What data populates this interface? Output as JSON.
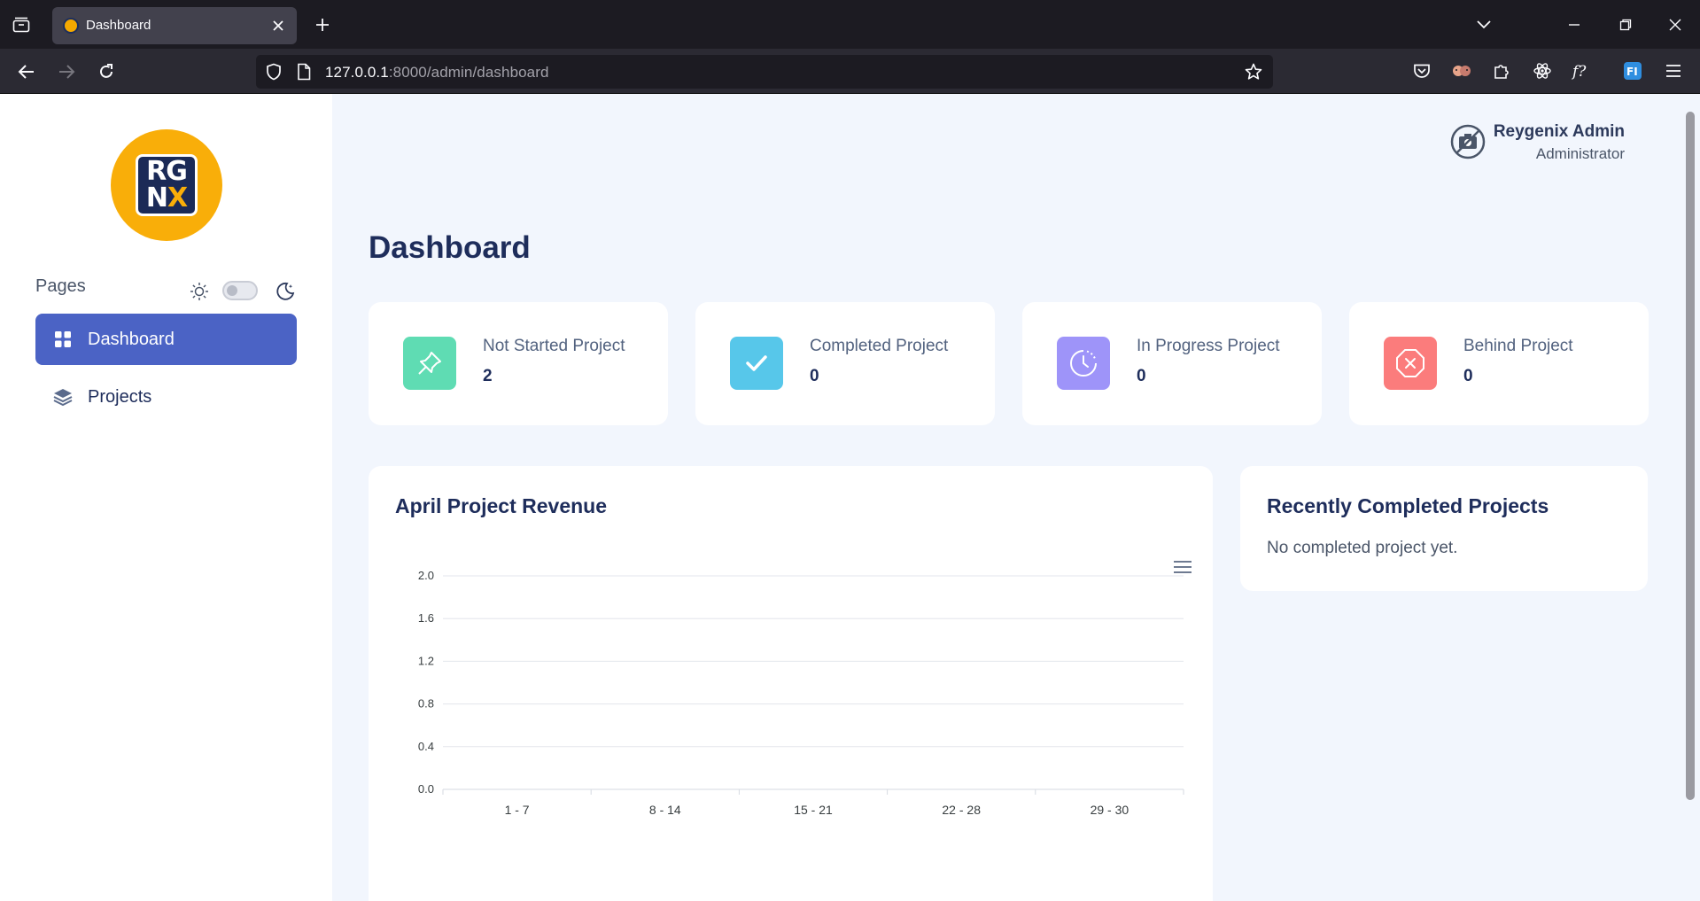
{
  "browser": {
    "tab_title": "Dashboard",
    "url_host": "127.0.0.1",
    "url_rest": ":8000/admin/dashboard"
  },
  "sidebar": {
    "pages_label": "Pages",
    "items": [
      {
        "label": "Dashboard",
        "icon": "grid-icon",
        "active": true
      },
      {
        "label": "Projects",
        "icon": "layers-icon",
        "active": false
      }
    ],
    "logo_line1": "RG",
    "logo_line2_a": "N",
    "logo_line2_b": "X"
  },
  "user": {
    "name": "Reygenix Admin",
    "role": "Administrator"
  },
  "main": {
    "title": "Dashboard"
  },
  "stats": [
    {
      "label": "Not Started Project",
      "value": "2",
      "icon": "pin-icon",
      "color": "#5fdcb3"
    },
    {
      "label": "Completed Project",
      "value": "0",
      "icon": "check-icon",
      "color": "#57c7ea"
    },
    {
      "label": "In Progress Project",
      "value": "0",
      "icon": "clock-icon",
      "color": "#9e94f9"
    },
    {
      "label": "Behind Project",
      "value": "0",
      "icon": "x-octagon-icon",
      "color": "#fb7c7c"
    }
  ],
  "revenue": {
    "title": "April Project Revenue"
  },
  "recent": {
    "title": "Recently Completed Projects",
    "empty_text": "No completed project yet."
  },
  "chart_data": {
    "type": "bar",
    "title": "April Project Revenue",
    "categories": [
      "1 - 7",
      "8 - 14",
      "15 - 21",
      "22 - 28",
      "29 - 30"
    ],
    "values": [
      0,
      0,
      0,
      0,
      0
    ],
    "y_ticks": [
      "0.0",
      "0.4",
      "0.8",
      "1.2",
      "1.6",
      "2.0"
    ],
    "ylim": [
      0,
      2
    ],
    "grid": true
  }
}
